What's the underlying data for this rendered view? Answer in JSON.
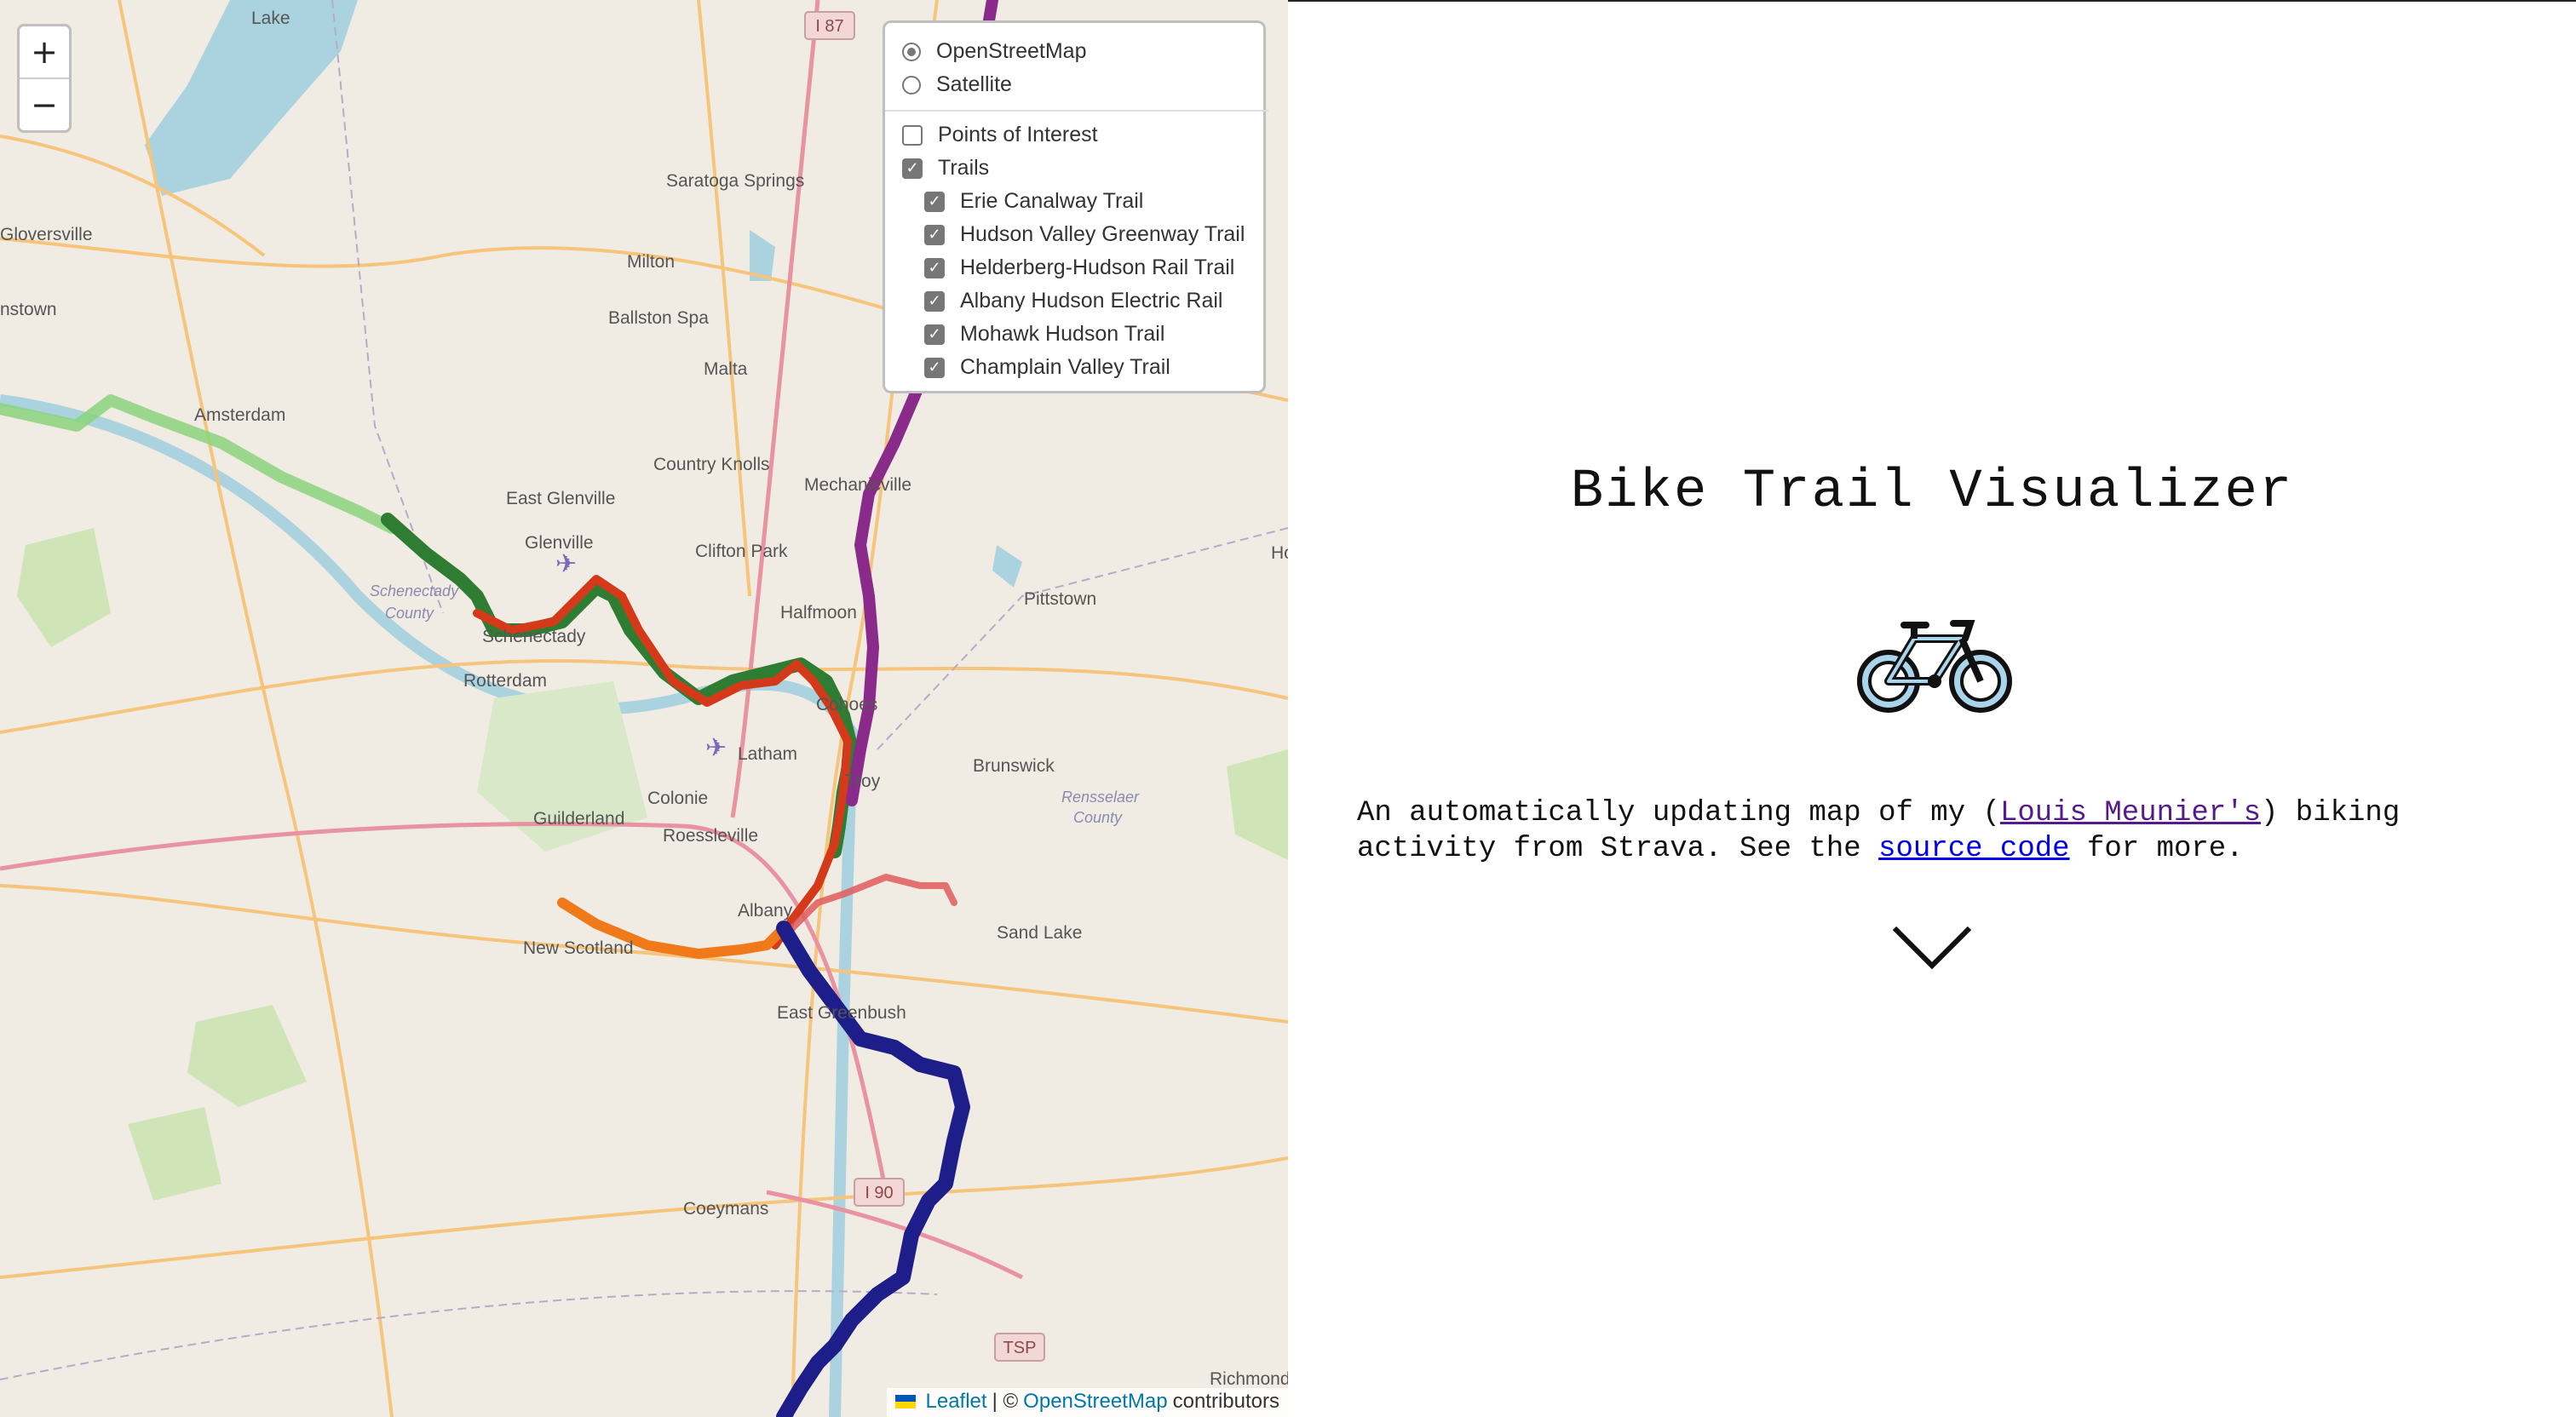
{
  "map": {
    "zoom_in_label": "+",
    "zoom_out_label": "−",
    "place_labels": [
      "Lake",
      "Gloversville",
      "nstown",
      "Amsterdam",
      "Milton",
      "Saratoga Springs",
      "Ballston Spa",
      "Malta",
      "Country Knolls",
      "East Glenville",
      "Glenville",
      "Clifton Park",
      "Mechanicville",
      "Halfmoon",
      "Schenectady",
      "Rotterdam",
      "Latham",
      "Cohoes",
      "Colonie",
      "Troy",
      "Guilderland",
      "Roessleville",
      "Brunswick",
      "Albany",
      "New Scotland",
      "Sand Lake",
      "East Greenbush",
      "Pittstown",
      "Coeymans",
      "Richmond",
      "Ho"
    ],
    "county_labels": [
      "Schenectady",
      "County",
      "Rensselaer",
      "County"
    ],
    "road_shields": [
      "I 87",
      "I 90",
      "TSP"
    ],
    "trail_colors": {
      "erie": "#8bd37c",
      "erie_dark": "#2f7d2f",
      "hudson": "#d43a1a",
      "helderberg": "#f07a1a",
      "albany_hudson": "#e05c5c",
      "mohawk": "#2e7d32",
      "champlain": "#8a2a8a",
      "blue": "#1e1e8a"
    }
  },
  "layers": {
    "base": [
      {
        "label": "OpenStreetMap",
        "selected": true
      },
      {
        "label": "Satellite",
        "selected": false
      }
    ],
    "overlays": [
      {
        "label": "Points of Interest",
        "checked": false
      },
      {
        "label": "Trails",
        "checked": true
      }
    ],
    "trails": [
      {
        "label": "Erie Canalway Trail",
        "checked": true
      },
      {
        "label": "Hudson Valley Greenway Trail",
        "checked": true
      },
      {
        "label": "Helderberg-Hudson Rail Trail",
        "checked": true
      },
      {
        "label": "Albany Hudson Electric Rail",
        "checked": true
      },
      {
        "label": "Mohawk Hudson Trail",
        "checked": true
      },
      {
        "label": "Champlain Valley Trail",
        "checked": true
      }
    ]
  },
  "attribution": {
    "leaflet": "Leaflet",
    "separator": "| ©",
    "osm": "OpenStreetMap",
    "contributors": "contributors"
  },
  "panel": {
    "title": "Bike Trail Visualizer",
    "bike_icon": "bicycle-icon",
    "desc_part1": "An automatically updating map of my (",
    "desc_link1": "Louis Meunier's",
    "desc_part2": ") biking activity from Strava. See the ",
    "desc_link2": "source code",
    "desc_part3": " for more.",
    "scroll_icon": "chevron-down-icon"
  }
}
